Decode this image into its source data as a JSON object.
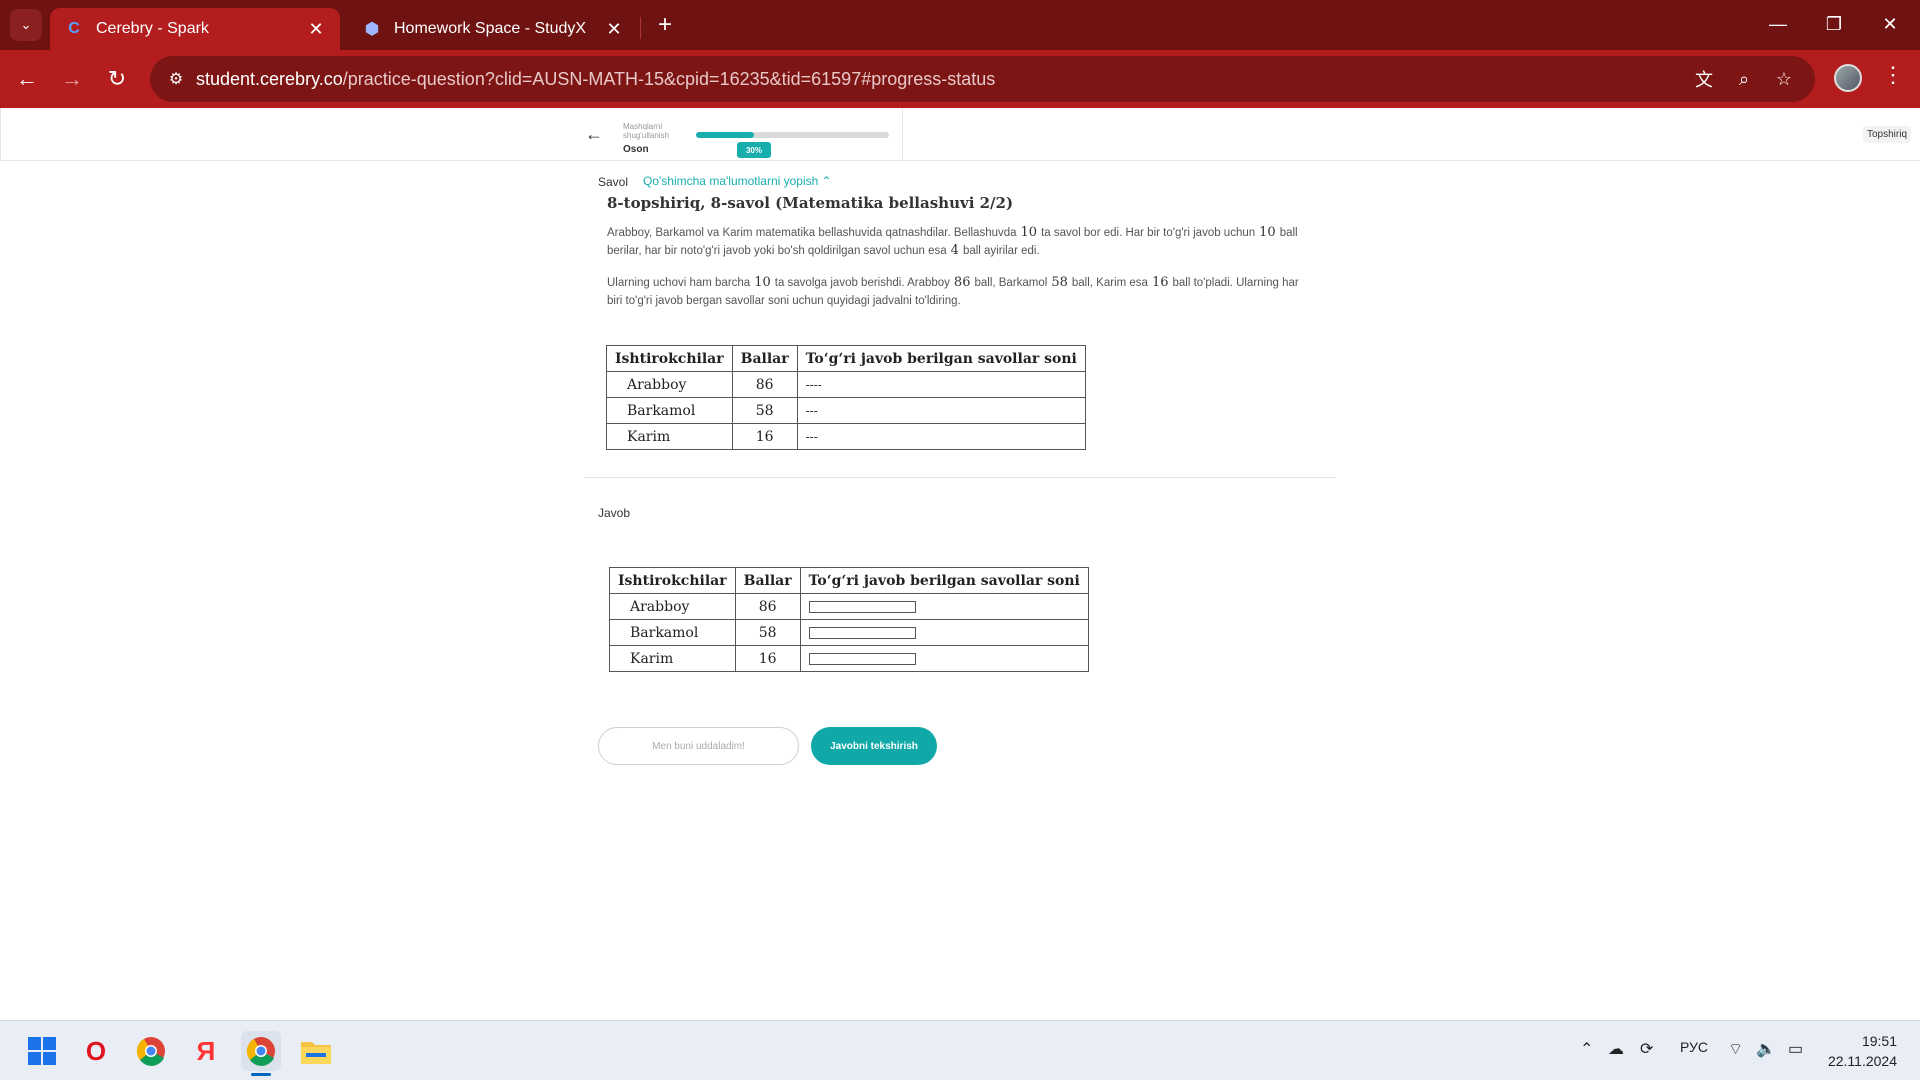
{
  "browser": {
    "tabs": [
      {
        "title": "Cerebry - Spark",
        "active": true,
        "icon": "cerebry-icon"
      },
      {
        "title": "Homework Space - StudyX",
        "active": false,
        "icon": "studyx-icon"
      }
    ],
    "url_host": "student.cerebry.co",
    "url_path": "/practice-question?clid=AUSN-MATH-15&cpid=16235&tid=61597#progress-status"
  },
  "header": {
    "level_small": "Mashqlarni shug'ullanish",
    "level": "Oson",
    "progress": 0.3,
    "progress_label": "30%",
    "submit_label": "Topshiriq"
  },
  "question": {
    "label": "Savol",
    "toggle": "Qo'shimcha ma'lumotlarni yopish ⌃",
    "title": "8-topshiriq, 8-savol (Matematika bellashuvi 2/2)",
    "p1": {
      "a": "Arabboy, Barkamol va Karim matematika bellashuvida qatnashdilar. Bellashuvda",
      "n1": "10",
      "b": "ta savol bor edi. Har bir to'g'ri javob uchun",
      "n2": "10",
      "c": "ball berilar, har bir noto'g'ri javob yoki bo'sh qoldirilgan savol uchun esa",
      "n3": "4",
      "d": "ball ayirilar edi."
    },
    "p2": {
      "a": "Ularning uchovi ham barcha",
      "n1": "10",
      "b": "ta savolga javob berishdi. Arabboy",
      "n2": "86",
      "c": "ball, Barkamol",
      "n3": "58",
      "d": "ball, Karim esa",
      "n4": "16",
      "e": "ball to'pladi. Ularning har biri to'g'ri javob bergan savollar soni uchun quyidagi jadvalni to'ldiring."
    },
    "table": {
      "headers": [
        "Ishtirokchilar",
        "Ballar",
        "To‘g‘ri javob berilgan savollar soni"
      ],
      "rows": [
        {
          "name": "Arabboy",
          "score": "86",
          "answer": "----"
        },
        {
          "name": "Barkamol",
          "score": "58",
          "answer": "---"
        },
        {
          "name": "Karim",
          "score": "16",
          "answer": "---"
        }
      ]
    }
  },
  "answer": {
    "label": "Javob",
    "table": {
      "headers": [
        "Ishtirokchilar",
        "Ballar",
        "To‘g‘ri javob berilgan savollar soni"
      ],
      "rows": [
        {
          "name": "Arabboy",
          "score": "86",
          "value": ""
        },
        {
          "name": "Barkamol",
          "score": "58",
          "value": ""
        },
        {
          "name": "Karim",
          "score": "16",
          "value": ""
        }
      ]
    },
    "skip_label": "Men buni uddaladim!",
    "check_label": "Javobni tekshirish"
  },
  "taskbar": {
    "apps": [
      "windows-start-icon",
      "opera-icon",
      "chrome-icon",
      "yandex-icon",
      "chrome-profile-icon",
      "file-explorer-icon"
    ],
    "lang": "РУС",
    "time": "19:51",
    "date": "22.11.2024"
  },
  "colors": {
    "accent": "#11a8a8",
    "browser_frame": "#6e1212",
    "browser_toolbar": "#b31d1d"
  }
}
